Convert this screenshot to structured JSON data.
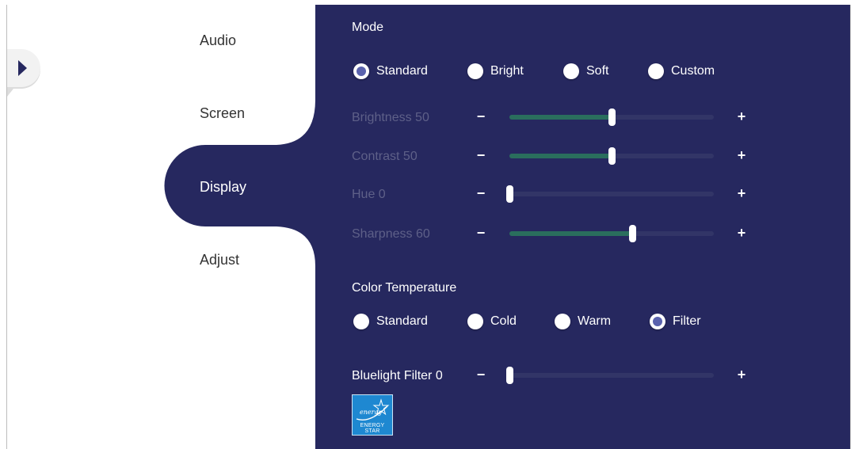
{
  "nav": {
    "items": [
      {
        "label": "Audio"
      },
      {
        "label": "Screen"
      },
      {
        "label": "Display"
      },
      {
        "label": "Adjust"
      }
    ],
    "active": "Display"
  },
  "mode": {
    "title": "Mode",
    "options": [
      {
        "label": "Standard",
        "selected": true
      },
      {
        "label": "Bright",
        "selected": false
      },
      {
        "label": "Soft",
        "selected": false
      },
      {
        "label": "Custom",
        "selected": false
      }
    ]
  },
  "sliders": [
    {
      "label": "Brightness 50",
      "value": 50,
      "enabled": false
    },
    {
      "label": "Contrast 50",
      "value": 50,
      "enabled": false
    },
    {
      "label": "Hue 0",
      "value": 0,
      "enabled": false
    },
    {
      "label": "Sharpness 60",
      "value": 60,
      "enabled": false
    }
  ],
  "color_temperature": {
    "title": "Color Temperature",
    "options": [
      {
        "label": "Standard",
        "selected": false
      },
      {
        "label": "Cold",
        "selected": false
      },
      {
        "label": "Warm",
        "selected": false
      },
      {
        "label": "Filter",
        "selected": true
      }
    ]
  },
  "bluelight": {
    "label": "Bluelight Filter 0",
    "value": 0
  },
  "controls": {
    "minus": "−",
    "plus": "+"
  },
  "logo": {
    "text": "ENERGY STAR",
    "script": "energy"
  },
  "colors": {
    "panel": "#26285f",
    "accent": "#5a62ad",
    "fill": "#2a6e5d"
  }
}
